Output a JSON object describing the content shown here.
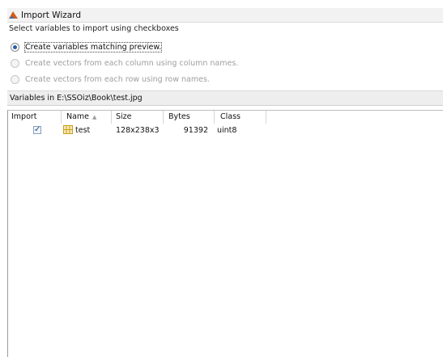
{
  "window": {
    "title": "Import Wizard",
    "app_icon": "matlab-icon"
  },
  "options": {
    "section_label": "Select variables to import using checkboxes",
    "items": [
      {
        "label": "Create variables matching preview.",
        "selected": true,
        "enabled": true
      },
      {
        "label": "Create vectors from each column using column names.",
        "selected": false,
        "enabled": false
      },
      {
        "label": "Create vectors from each row using row names.",
        "selected": false,
        "enabled": false
      }
    ]
  },
  "variables": {
    "header": "Variables in E:\\SSOiz\\Book\\test.jpg",
    "columns": [
      "Import",
      "Name",
      "Size",
      "Bytes",
      "Class"
    ],
    "sort_column": "Name",
    "sort_direction": "ascending",
    "rows": [
      {
        "import": true,
        "name": "test",
        "size": "128x238x3",
        "bytes": "91392",
        "class": "uint8",
        "icon": "matrix-variable-icon"
      }
    ]
  },
  "colors": {
    "title_bar": "#f2f2f2",
    "radio_selected": "#2a5fa8",
    "variable_icon": "#c9a11c"
  }
}
